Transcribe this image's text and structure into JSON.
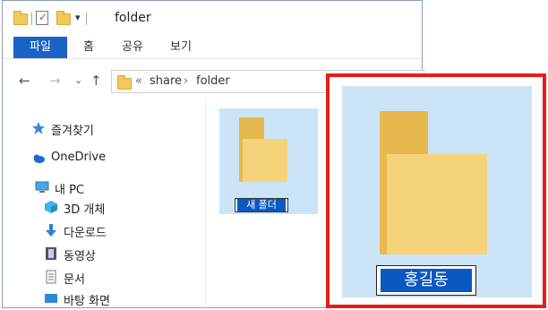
{
  "window": {
    "title": "folder"
  },
  "ribbon": {
    "tabs": [
      "파일",
      "홈",
      "공유",
      "보기"
    ]
  },
  "address": {
    "back": "←",
    "forward": "→",
    "recent": "⌄",
    "up": "↑",
    "overflow": "«",
    "path": [
      "share",
      "folder"
    ],
    "separator": "›"
  },
  "nav": {
    "items": [
      {
        "label": "즐겨찾기",
        "icon": "star-icon"
      },
      {
        "label": "OneDrive",
        "icon": "cloud-icon"
      },
      {
        "label": "내 PC",
        "icon": "computer-icon"
      },
      {
        "label": "3D 개체",
        "icon": "cube-icon"
      },
      {
        "label": "다운로드",
        "icon": "download-arrow-icon"
      },
      {
        "label": "동영상",
        "icon": "film-icon"
      },
      {
        "label": "문서",
        "icon": "document-icon"
      },
      {
        "label": "바탕 화면",
        "icon": "desktop-icon"
      }
    ]
  },
  "content": {
    "new_folder_name": "새 폴더"
  },
  "zoom": {
    "folder_name": "홍길동"
  },
  "colors": {
    "accent": "#1a63c6",
    "highlight": "#ea1b1b",
    "selection": "#cce4f7"
  }
}
